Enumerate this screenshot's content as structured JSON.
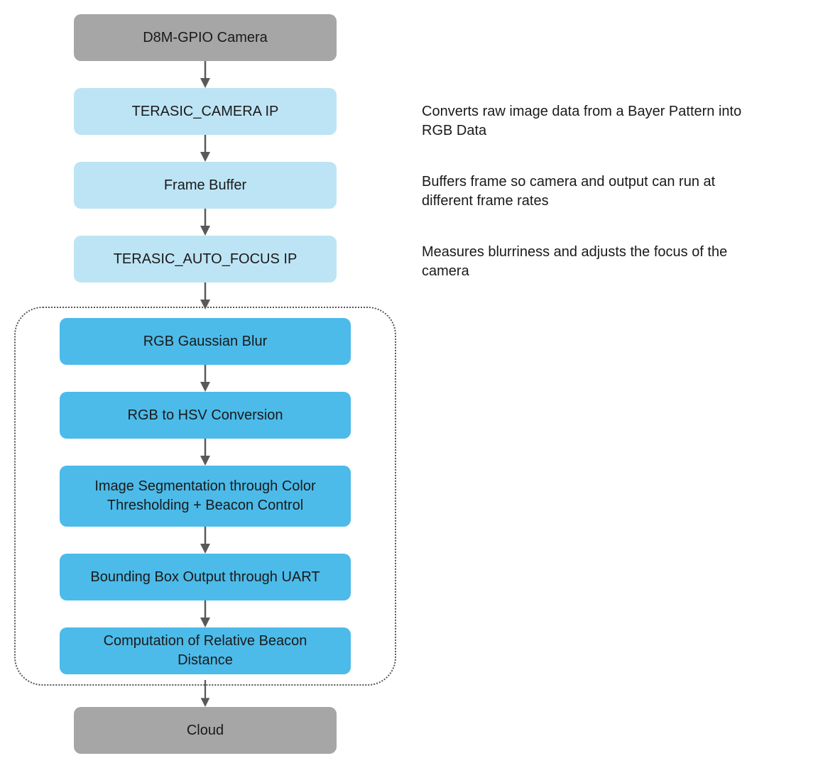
{
  "nodes": {
    "camera": "D8M-GPIO Camera",
    "terasic_camera": "TERASIC_CAMERA IP",
    "frame_buffer": "Frame Buffer",
    "auto_focus": "TERASIC_AUTO_FOCUS IP",
    "gaussian_blur": "RGB Gaussian Blur",
    "rgb_hsv": "RGB to HSV Conversion",
    "segmentation": "Image Segmentation through Color Thresholding + Beacon Control",
    "bbox_uart": "Bounding Box Output through UART",
    "beacon_distance": "Computation of Relative Beacon Distance",
    "cloud": "Cloud"
  },
  "annotations": {
    "terasic_camera": "Converts raw image data from a Bayer Pattern into RGB Data",
    "frame_buffer": "Buffers frame so camera and output can run at different frame rates",
    "auto_focus": "Measures blurriness and adjusts the focus of the camera"
  },
  "colors": {
    "gray": "#a6a6a6",
    "light_blue": "#bde4f4",
    "blue": "#4cbbe9",
    "arrow": "#595959"
  }
}
